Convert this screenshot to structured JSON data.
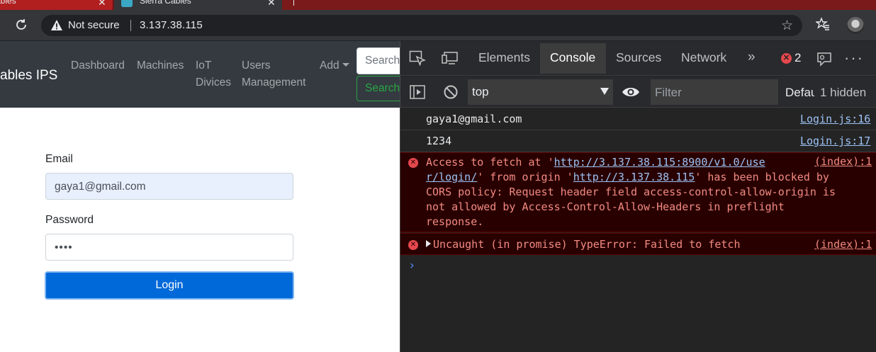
{
  "browser": {
    "tabs": [
      {
        "title": "ables"
      },
      {
        "title": "Sierra Cables"
      }
    ],
    "tab_close": "✕",
    "security": "Not secure",
    "url": "3.137.38.115"
  },
  "page": {
    "brand": "ables IPS",
    "nav": {
      "dashboard": "Dashboard",
      "machines": "Machines",
      "iot_line1": "IoT",
      "iot_line2": "Divices",
      "users_line1": "Users",
      "users_line2": "Management",
      "add": "Add"
    },
    "search_placeholder": "Search",
    "search_button": "Search",
    "form": {
      "email_label": "Email",
      "email_value": "gaya1@gmail.com",
      "password_label": "Password",
      "password_value": "••••",
      "login_button": "Login"
    }
  },
  "devtools": {
    "tabs": {
      "elements": "Elements",
      "console": "Console",
      "sources": "Sources",
      "network": "Network",
      "more": "»"
    },
    "error_count": "2",
    "context": "top",
    "filter_placeholder": "Filter",
    "levels": "Default levels",
    "hidden": "1 hidden",
    "messages": {
      "email": {
        "text": "gaya1@gmail.com",
        "source": "Login.js:16"
      },
      "password": {
        "text": "1234",
        "source": "Login.js:17"
      },
      "cors": {
        "pre": "Access to fetch at '",
        "link1a": "http://3.137.38.115:8900/v1.0/use",
        "link1b": "r/login/",
        "mid": "' from origin '",
        "link2": "http://3.137.38.115",
        "post1": "' has been blocked by",
        "line3": "CORS policy: Request header field access-control-allow-origin is",
        "line4": "not allowed by Access-Control-Allow-Headers in preflight",
        "line5": "response.",
        "source": "(index):1"
      },
      "uncaught": {
        "text": "Uncaught (in promise) TypeError: Failed to fetch",
        "source": "(index):1"
      }
    },
    "prompt": "›"
  },
  "colors": {
    "navbar": "#343a40",
    "login_button": "#0069d9",
    "success": "#28a745",
    "error_text": "#f28b82",
    "error_bg": "#290000"
  }
}
